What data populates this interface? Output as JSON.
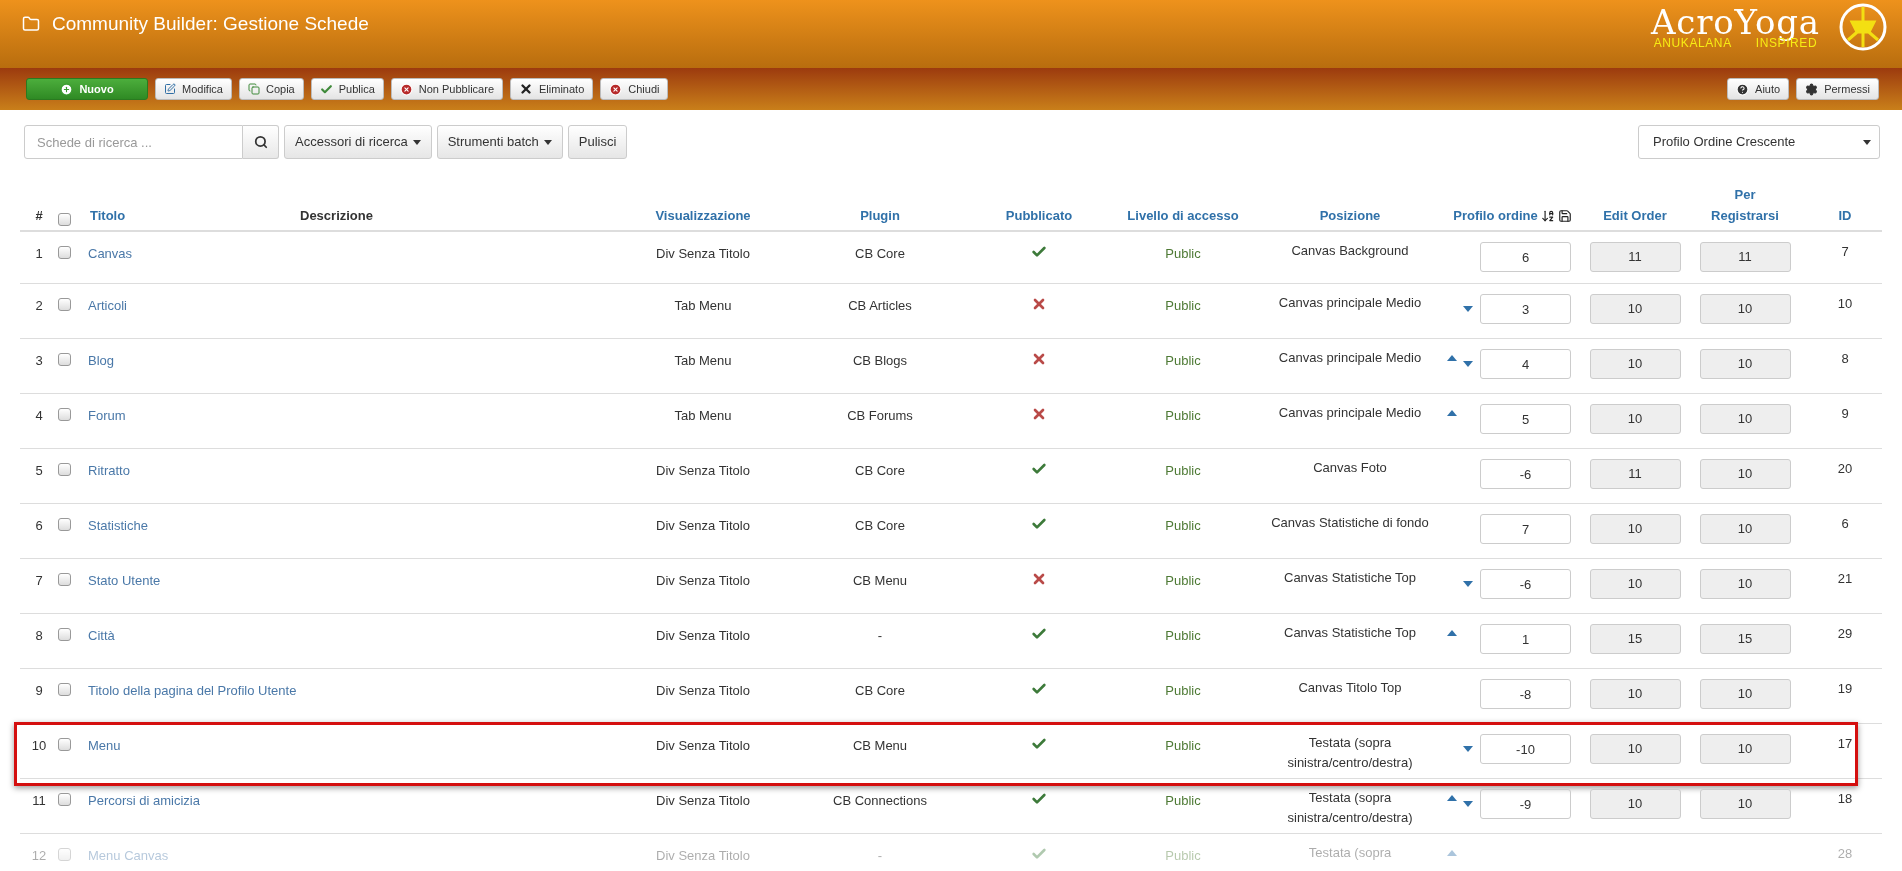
{
  "header": {
    "title": "Community Builder: Gestione Schede",
    "logo": {
      "word": "AcroYoga",
      "left_tag": "ANUKALANA",
      "right_tag": "INSPIRED"
    }
  },
  "toolbar": {
    "left": [
      {
        "label": "Nuovo",
        "kind": "primary"
      },
      {
        "label": "Modifica",
        "kind": "default"
      },
      {
        "label": "Copia",
        "kind": "default"
      },
      {
        "label": "Publica",
        "kind": "default"
      },
      {
        "label": "Non Pubblicare",
        "kind": "default"
      },
      {
        "label": "Eliminato",
        "kind": "default"
      },
      {
        "label": "Chiudi",
        "kind": "default"
      }
    ],
    "right": [
      {
        "label": "Aiuto"
      },
      {
        "label": "Permessi"
      }
    ]
  },
  "filters": {
    "search_placeholder": "Schede di ricerca ...",
    "buttons": [
      "Accessori di ricerca",
      "Strumenti batch"
    ],
    "clear": "Pulisci",
    "sort_select": "Profilo Ordine Crescente"
  },
  "table": {
    "select_all_checked": false,
    "columns": {
      "num": "#",
      "title": "Titolo",
      "description": "Descrizione",
      "view": "Visualizzazione",
      "plugin": "Plugin",
      "published": "Pubblicato",
      "access": "Livello di accesso",
      "position": "Posizione",
      "order": "Profilo ordine",
      "edit_order": "Edit Order",
      "register_1": "Per",
      "register_2": "Registrarsi",
      "id": "ID"
    },
    "rows": [
      {
        "num": "1",
        "checked": false,
        "title": "Canvas",
        "view": "Div Senza Titolo",
        "plugin": "CB Core",
        "published": true,
        "access": "Public",
        "position": "Canvas Background",
        "up": false,
        "down": false,
        "order": "6",
        "edit_order": "11",
        "register": "11",
        "id": "7",
        "highlighted": false,
        "dimmed": false
      },
      {
        "num": "2",
        "checked": false,
        "title": "Articoli",
        "view": "Tab Menu",
        "plugin": "CB Articles",
        "published": false,
        "access": "Public",
        "position": "Canvas principale Medio",
        "up": false,
        "down": true,
        "order": "3",
        "edit_order": "10",
        "register": "10",
        "id": "10",
        "highlighted": false,
        "dimmed": false
      },
      {
        "num": "3",
        "checked": false,
        "title": "Blog",
        "view": "Tab Menu",
        "plugin": "CB Blogs",
        "published": false,
        "access": "Public",
        "position": "Canvas principale Medio",
        "up": true,
        "down": true,
        "order": "4",
        "edit_order": "10",
        "register": "10",
        "id": "8",
        "highlighted": false,
        "dimmed": false
      },
      {
        "num": "4",
        "checked": false,
        "title": "Forum",
        "view": "Tab Menu",
        "plugin": "CB Forums",
        "published": false,
        "access": "Public",
        "position": "Canvas principale Medio",
        "up": true,
        "down": false,
        "order": "5",
        "edit_order": "10",
        "register": "10",
        "id": "9",
        "highlighted": false,
        "dimmed": false
      },
      {
        "num": "5",
        "checked": false,
        "title": "Ritratto",
        "view": "Div Senza Titolo",
        "plugin": "CB Core",
        "published": true,
        "access": "Public",
        "position": "Canvas Foto",
        "up": false,
        "down": false,
        "order": "-6",
        "edit_order": "11",
        "register": "10",
        "id": "20",
        "highlighted": false,
        "dimmed": false
      },
      {
        "num": "6",
        "checked": false,
        "title": "Statistiche",
        "view": "Div Senza Titolo",
        "plugin": "CB Core",
        "published": true,
        "access": "Public",
        "position": "Canvas Statistiche di fondo",
        "up": false,
        "down": false,
        "order": "7",
        "edit_order": "10",
        "register": "10",
        "id": "6",
        "highlighted": false,
        "dimmed": false
      },
      {
        "num": "7",
        "checked": false,
        "title": "Stato Utente",
        "view": "Div Senza Titolo",
        "plugin": "CB Menu",
        "published": false,
        "access": "Public",
        "position": "Canvas Statistiche Top",
        "up": false,
        "down": true,
        "order": "-6",
        "edit_order": "10",
        "register": "10",
        "id": "21",
        "highlighted": false,
        "dimmed": false
      },
      {
        "num": "8",
        "checked": false,
        "title": "Città",
        "view": "Div Senza Titolo",
        "plugin": "-",
        "published": true,
        "access": "Public",
        "position": "Canvas Statistiche Top",
        "up": true,
        "down": false,
        "order": "1",
        "edit_order": "15",
        "register": "15",
        "id": "29",
        "highlighted": false,
        "dimmed": false
      },
      {
        "num": "9",
        "checked": false,
        "title": "Titolo della pagina del Profilo Utente",
        "view": "Div Senza Titolo",
        "plugin": "CB Core",
        "published": true,
        "access": "Public",
        "position": "Canvas Titolo Top",
        "up": false,
        "down": false,
        "order": "-8",
        "edit_order": "10",
        "register": "10",
        "id": "19",
        "highlighted": false,
        "dimmed": false
      },
      {
        "num": "10",
        "checked": false,
        "title": "Menu",
        "view": "Div Senza Titolo",
        "plugin": "CB Menu",
        "published": true,
        "access": "Public",
        "position": "Testata (sopra sinistra/centro/destra)",
        "up": false,
        "down": true,
        "order": "-10",
        "edit_order": "10",
        "register": "10",
        "id": "17",
        "highlighted": true,
        "dimmed": false
      },
      {
        "num": "11",
        "checked": false,
        "title": "Percorsi di amicizia",
        "view": "Div Senza Titolo",
        "plugin": "CB Connections",
        "published": true,
        "access": "Public",
        "position": "Testata (sopra sinistra/centro/destra)",
        "up": true,
        "down": true,
        "order": "-9",
        "edit_order": "10",
        "register": "10",
        "id": "18",
        "highlighted": false,
        "dimmed": false
      },
      {
        "num": "12",
        "checked": false,
        "title": "Menu Canvas",
        "view": "Div Senza Titolo",
        "plugin": "-",
        "published": true,
        "access": "Public",
        "position": "Testata (sopra",
        "up": true,
        "down": false,
        "id": "28",
        "highlighted": false,
        "dimmed": true
      }
    ]
  }
}
